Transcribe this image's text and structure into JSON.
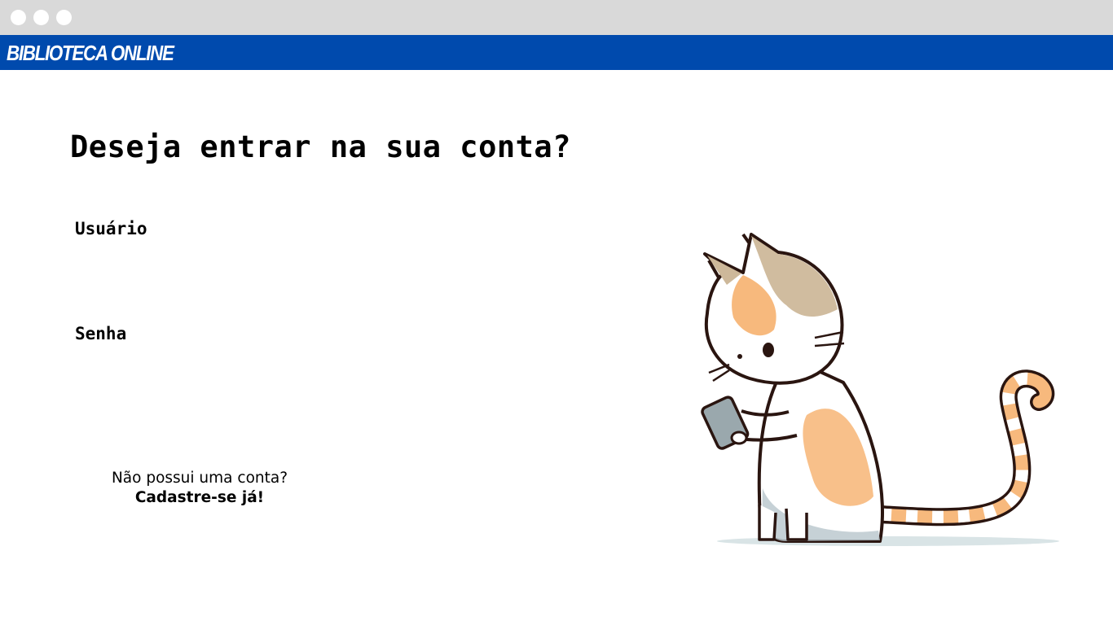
{
  "header": {
    "brand": "BIBLIOTECA ONLINE"
  },
  "login": {
    "title": "Deseja entrar na sua conta?",
    "username_label": "Usuário",
    "username_value": "",
    "password_label": "Senha",
    "password_value": ""
  },
  "signup": {
    "prompt": "Não possui uma conta?",
    "link": "Cadastre-se já!"
  },
  "colors": {
    "header": "#004aad",
    "chrome": "#d9d9d9",
    "cat_orange": "#f7b97d",
    "cat_gray": "#b8c6cc"
  }
}
